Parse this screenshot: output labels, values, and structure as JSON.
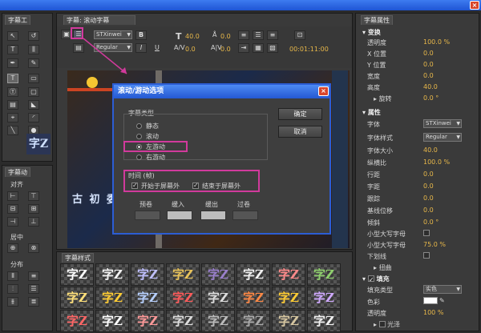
{
  "window": {
    "close_glyph": "×"
  },
  "tools_panel": {
    "title": "字幕工",
    "preview_text": "字Z"
  },
  "actions_panel": {
    "title": "字幕动",
    "align_label": "对齐",
    "center_label": "居中",
    "distribute_label": "分布"
  },
  "title_panel": {
    "tab_label": "字幕: 滚动字幕",
    "font_family": "STXinwei",
    "font_style": "Regular",
    "font_size": "40.0",
    "kerning": "0.0",
    "leading": "0.0",
    "tracking": "0.0",
    "timecode": "00:01:11:00",
    "canvas_text": "古 初 委"
  },
  "styles_panel": {
    "title": "字幕样式",
    "sample_text": "字Z",
    "thumb_colors": [
      "#ffffff",
      "#f4f4f4",
      "#c0c0ff",
      "#e8c35a",
      "#9a7fcc",
      "#f2f2f2",
      "#ff8a8a",
      "#8fd06d",
      "#ffe07a",
      "#ffcc33",
      "#b7d0ff",
      "#ff5a5a",
      "#dddddd",
      "#ff8844",
      "#ffcc33",
      "#cfa9ff",
      "#ff6666",
      "#ffffff",
      "#ff9999",
      "#dddddd",
      "#bbbbbb",
      "#aaaaaa",
      "#d6c6a0",
      "#f0f0f0"
    ]
  },
  "properties_panel": {
    "title": "字幕属性",
    "transform_header": "变换",
    "opacity_label": "透明度",
    "opacity_value": "100.0 %",
    "x_label": "X 位置",
    "x_value": "0.0",
    "y_label": "Y 位置",
    "y_value": "0.0",
    "width_label": "宽度",
    "width_value": "0.0",
    "height_label": "高度",
    "height_value": "40.0",
    "rotation_label": "旋转",
    "rotation_value": "0.0 °",
    "properties_header": "属性",
    "font_label": "字体",
    "font_value": "STXinwei",
    "font_style_label": "字体样式",
    "font_style_value": "Regular",
    "font_size_label": "字体大小",
    "font_size_value": "40.0",
    "aspect_label": "纵横比",
    "aspect_value": "100.0 %",
    "leading_label": "行距",
    "leading_value": "0.0",
    "kerning_label": "字距",
    "kerning_value": "0.0",
    "tracking_label": "跟踪",
    "tracking_value": "0.0",
    "baseline_label": "基线位移",
    "baseline_value": "0.0",
    "slant_label": "倾斜",
    "slant_value": "0.0 °",
    "smallcaps_label": "小型大写字母",
    "smallcaps_size_label": "小型大写字母",
    "smallcaps_size_value": "75.0 %",
    "underline_label": "下划线",
    "distort_label": "扭曲",
    "fill_header": "填充",
    "fill_type_label": "填充类型",
    "fill_type_value": "实色",
    "color_label": "色彩",
    "fill_opacity_label": "透明度",
    "fill_opacity_value": "100 %",
    "sheen_label": "光泽"
  },
  "dialog": {
    "title": "滚动/游动选项",
    "close_glyph": "×",
    "type_group_label": "字幕类型",
    "options": [
      "静态",
      "滚动",
      "左游动",
      "右游动"
    ],
    "selected_option": "左游动",
    "timing_label": "时间 (帧)",
    "start_off_screen": "开始于屏幕外",
    "end_off_screen": "结束于屏幕外",
    "preroll_label": "预卷",
    "ease_in_label": "缓入",
    "ease_out_label": "缓出",
    "postroll_label": "过卷",
    "ok_label": "确定",
    "cancel_label": "取消"
  },
  "colors": {
    "accent_highlight": "#d13a9c",
    "value_orange": "#e8b84a",
    "dialog_border": "#2c5dd4"
  }
}
